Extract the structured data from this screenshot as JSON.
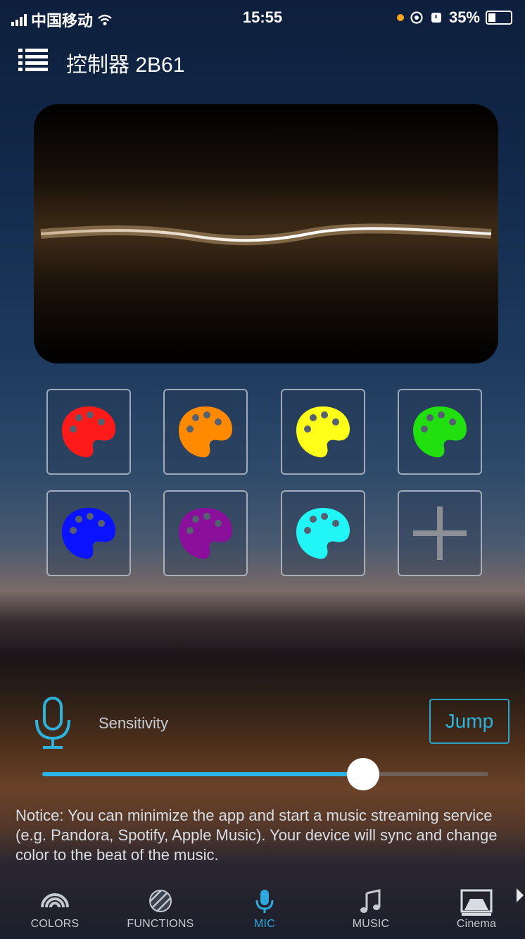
{
  "status_bar": {
    "carrier": "中国移动",
    "time": "15:55",
    "battery": "35%"
  },
  "header": {
    "title": "控制器 2B61"
  },
  "palettes": [
    {
      "color": "#ff1a1a",
      "icon": "palette-icon"
    },
    {
      "color": "#ff8a00",
      "icon": "palette-icon"
    },
    {
      "color": "#ffff1a",
      "icon": "palette-icon"
    },
    {
      "color": "#22e010",
      "icon": "palette-icon"
    },
    {
      "color": "#0a12ff",
      "icon": "palette-icon"
    },
    {
      "color": "#8a0f9a",
      "icon": "palette-icon"
    },
    {
      "color": "#22f5f5",
      "icon": "palette-icon"
    },
    {
      "color": null,
      "icon": "plus-icon"
    }
  ],
  "mic": {
    "label": "Sensitivity",
    "jump_label": "Jump",
    "sensitivity_percent": 72
  },
  "notice": "Notice: You can minimize the app and start a music streaming service (e.g. Pandora, Spotify, Apple Music). Your device will sync and change color to the beat of the music.",
  "tabs": [
    {
      "label": "COLORS",
      "icon": "rainbow-icon",
      "active": false
    },
    {
      "label": "FUNCTIONS",
      "icon": "striped-circle-icon",
      "active": false
    },
    {
      "label": "MIC",
      "icon": "microphone-icon",
      "active": true
    },
    {
      "label": "MUSIC",
      "icon": "music-note-icon",
      "active": false
    },
    {
      "label": "Cinema",
      "icon": "cinema-screen-icon",
      "active": false
    }
  ],
  "colors": {
    "accent": "#2fa8dd"
  }
}
